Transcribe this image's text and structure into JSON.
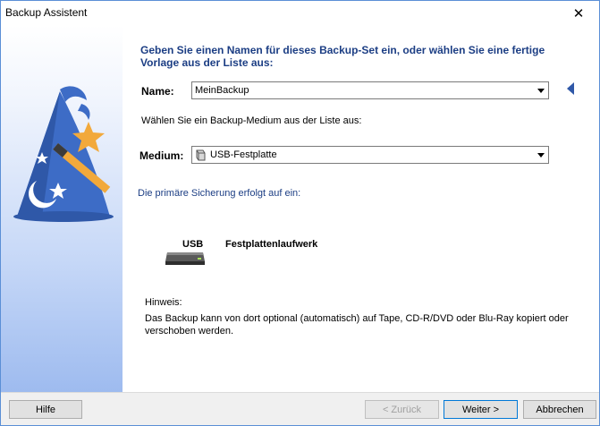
{
  "window": {
    "title": "Backup Assistent",
    "close_glyph": "✕"
  },
  "heading": "Geben Sie einen Namen für dieses Backup-Set ein, oder wählen Sie eine fertige Vorlage aus der Liste aus:",
  "name_field": {
    "label": "Name:",
    "value": "MeinBackup"
  },
  "medium_prompt": "Wählen Sie ein Backup-Medium aus der Liste aus:",
  "medium_field": {
    "label": "Medium:",
    "value": "USB-Festplatte",
    "icon": "drive-icon"
  },
  "primary_info": "Die primäre Sicherung erfolgt auf ein:",
  "device": {
    "badge": "USB",
    "name": "Festplattenlaufwerk",
    "icon": "usb-drive-icon"
  },
  "hint": {
    "title": "Hinweis:",
    "text": "Das Backup kann von dort optional (automatisch) auf Tape, CD-R/DVD oder Blu-Ray kopiert oder verschoben werden."
  },
  "buttons": {
    "help": "Hilfe",
    "back": "< Zurück",
    "next": "Weiter >",
    "cancel": "Abbrechen"
  },
  "colors": {
    "accent": "#1c3e84",
    "window_border": "#5b8fd6",
    "wizard_hat": "#3d6cc6",
    "star": "#f2a93b"
  }
}
